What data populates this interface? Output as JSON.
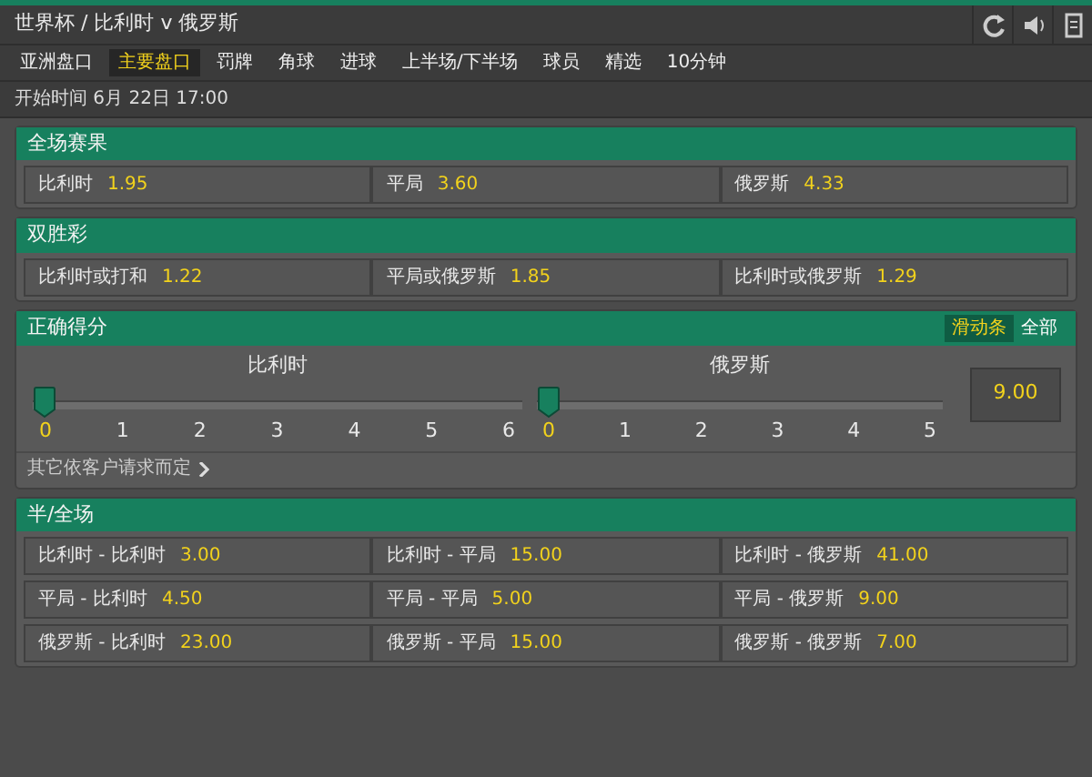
{
  "header": {
    "title": "世界杯 / 比利时 v 俄罗斯"
  },
  "tabs": [
    {
      "label": "亚洲盘口",
      "selected": false
    },
    {
      "label": "主要盘口",
      "selected": true
    },
    {
      "label": "罚牌",
      "selected": false
    },
    {
      "label": "角球",
      "selected": false
    },
    {
      "label": "进球",
      "selected": false
    },
    {
      "label": "上半场/下半场",
      "selected": false
    },
    {
      "label": "球员",
      "selected": false
    },
    {
      "label": "精选",
      "selected": false
    },
    {
      "label": "10分钟",
      "selected": false
    }
  ],
  "start_time": "开始时间 6月 22日 17:00",
  "markets": [
    {
      "kind": "grid",
      "title": "全场赛果",
      "rows": [
        [
          {
            "label": "比利时",
            "odds": "1.95"
          },
          {
            "label": "平局",
            "odds": "3.60"
          },
          {
            "label": "俄罗斯",
            "odds": "4.33"
          }
        ]
      ]
    },
    {
      "kind": "grid",
      "title": "双胜彩",
      "rows": [
        [
          {
            "label": "比利时或打和",
            "odds": "1.22"
          },
          {
            "label": "平局或俄罗斯",
            "odds": "1.85"
          },
          {
            "label": "比利时或俄罗斯",
            "odds": "1.29"
          }
        ]
      ]
    },
    {
      "kind": "score",
      "title": "正确得分",
      "toggles": [
        {
          "label": "滑动条",
          "selected": true
        },
        {
          "label": "全部",
          "selected": false
        }
      ],
      "sliders": [
        {
          "team": "比利时",
          "level": 0,
          "ticks": [
            {
              "label": "0",
              "selected": true
            },
            {
              "label": "1",
              "selected": false
            },
            {
              "label": "2",
              "selected": false
            },
            {
              "label": "3",
              "selected": false
            },
            {
              "label": "4",
              "selected": false
            },
            {
              "label": "5",
              "selected": false
            },
            {
              "label": "6",
              "selected": false
            }
          ]
        },
        {
          "team": "俄罗斯",
          "level": 0,
          "ticks": [
            {
              "label": "0",
              "selected": true
            },
            {
              "label": "1",
              "selected": false
            },
            {
              "label": "2",
              "selected": false
            },
            {
              "label": "3",
              "selected": false
            },
            {
              "label": "4",
              "selected": false
            },
            {
              "label": "5",
              "selected": false
            }
          ]
        }
      ],
      "price": "9.00",
      "link": "其它依客户请求而定"
    },
    {
      "kind": "grid",
      "title": "半/全场",
      "rows": [
        [
          {
            "label": "比利时 - 比利时",
            "odds": "3.00"
          },
          {
            "label": "比利时 - 平局",
            "odds": "15.00"
          },
          {
            "label": "比利时 - 俄罗斯",
            "odds": "41.00"
          }
        ],
        [
          {
            "label": "平局 - 比利时",
            "odds": "4.50"
          },
          {
            "label": "平局 - 平局",
            "odds": "5.00"
          },
          {
            "label": "平局 - 俄罗斯",
            "odds": "9.00"
          }
        ],
        [
          {
            "label": "俄罗斯 - 比利时",
            "odds": "23.00"
          },
          {
            "label": "俄罗斯 - 平局",
            "odds": "15.00"
          },
          {
            "label": "俄罗斯 - 俄罗斯",
            "odds": "7.00"
          }
        ]
      ]
    }
  ]
}
